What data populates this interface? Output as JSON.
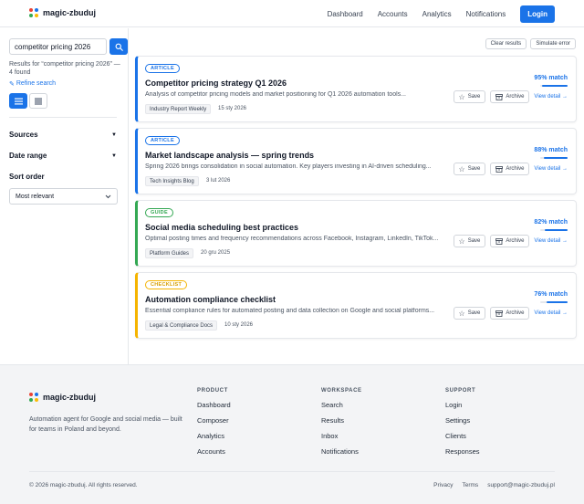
{
  "header": {
    "brand": "magic-zbuduj",
    "nav": [
      "Dashboard",
      "Accounts",
      "Analytics",
      "Notifications"
    ],
    "login_label": "Login"
  },
  "colors": {
    "accent": "#1a73e8",
    "logo_dots": [
      "#ea4335",
      "#1a73e8",
      "#34a853",
      "#fbbc05"
    ],
    "article": "#1a73e8",
    "guide": "#34a853",
    "checklist": "#f5b400"
  },
  "sidebar": {
    "search_value": "competitor pricing 2026",
    "search_icon": "search-icon",
    "results_text": "Results for “competitor pricing 2026” — 4 found",
    "refine_label": "Refine search",
    "filters": [
      {
        "label": "Sources"
      },
      {
        "label": "Date range"
      }
    ],
    "sort_label": "Sort order",
    "sort_value": "Most relevant"
  },
  "main": {
    "clear_label": "Clear results",
    "simulate_label": "Simulate error",
    "save_label": "Save",
    "archive_label": "Archive",
    "view_detail_label": "View detail →",
    "results": [
      {
        "type": "ARTICLE",
        "title": "Competitor pricing strategy Q1 2026",
        "description": "Analysis of competitor pricing models and market positioning for Q1 2026 automation tools...",
        "source": "Industry Report Weekly",
        "date": "15 sty 2026",
        "match": "95% match",
        "match_value": 0.95
      },
      {
        "type": "ARTICLE",
        "title": "Market landscape analysis — spring trends",
        "description": "Spring 2026 brings consolidation in social automation. Key players investing in AI-driven scheduling...",
        "source": "Tech Insights Blog",
        "date": "3 lut 2026",
        "match": "88% match",
        "match_value": 0.88
      },
      {
        "type": "GUIDE",
        "title": "Social media scheduling best practices",
        "description": "Optimal posting times and frequency recommendations across Facebook, Instagram, LinkedIn, TikTok...",
        "source": "Platform Guides",
        "date": "20 gru 2025",
        "match": "82% match",
        "match_value": 0.82
      },
      {
        "type": "CHECKLIST",
        "title": "Automation compliance checklist",
        "description": "Essential compliance rules for automated posting and data collection on Google and social platforms...",
        "source": "Legal & Compliance Docs",
        "date": "10 sty 2026",
        "match": "76% match",
        "match_value": 0.76
      }
    ]
  },
  "footer": {
    "brand": "magic-zbuduj",
    "tagline": "Automation agent for Google and social media — built for teams in Poland and beyond.",
    "columns": [
      {
        "title": "PRODUCT",
        "links": [
          "Dashboard",
          "Composer",
          "Analytics",
          "Accounts"
        ]
      },
      {
        "title": "WORKSPACE",
        "links": [
          "Search",
          "Results",
          "Inbox",
          "Notifications"
        ]
      },
      {
        "title": "SUPPORT",
        "links": [
          "Login",
          "Settings",
          "Clients",
          "Responses"
        ]
      }
    ],
    "copyright": "© 2026 magic-zbuduj. All rights reserved.",
    "bottom_links": [
      "Privacy",
      "Terms",
      "support@magic-zbuduj.pl"
    ]
  }
}
